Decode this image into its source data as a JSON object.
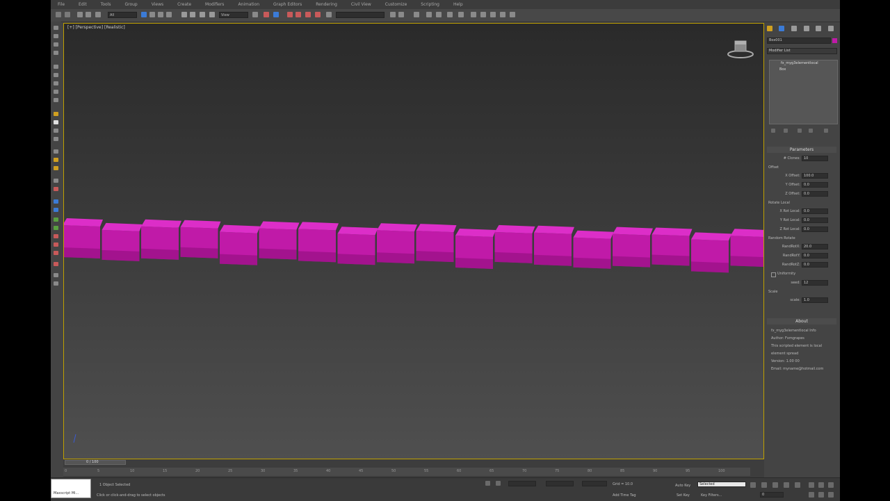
{
  "menu": [
    "File",
    "Edit",
    "Tools",
    "Group",
    "Views",
    "Create",
    "Modifiers",
    "Animation",
    "Graph Editors",
    "Rendering",
    "Civil View",
    "Customize",
    "Scripting",
    "Help"
  ],
  "toolbar": {
    "selection_set": "All",
    "reference_coord": "View",
    "named_selection": ""
  },
  "viewport": {
    "labels": [
      "[+]",
      "[Perspective]",
      "[Realistic]"
    ],
    "box_color": "#c01aa8",
    "box_top_color": "#dc2ec8",
    "box_dark_color": "#8a0f78"
  },
  "command_panel": {
    "object_name": "Box001",
    "modifier_list_label": "Modifier List",
    "stack": [
      "fx_myg3elementlocal",
      "Box"
    ],
    "params_title": "Parameters",
    "fields": [
      {
        "label": "# Clones:",
        "value": "10"
      },
      {
        "section": "Offset"
      },
      {
        "label": "X Offset:",
        "value": "100.0"
      },
      {
        "label": "Y Offset:",
        "value": "0.0"
      },
      {
        "label": "Z Offset:",
        "value": "0.0"
      },
      {
        "section": "Rotate Local"
      },
      {
        "label": "X Rot Local:",
        "value": "0.0"
      },
      {
        "label": "Y Rot Local:",
        "value": "0.0"
      },
      {
        "label": "Z Rot Local:",
        "value": "0.0"
      },
      {
        "section": "Random Rotate"
      },
      {
        "label": "RandRotX:",
        "value": "20.0"
      },
      {
        "label": "RandRotY:",
        "value": "0.0"
      },
      {
        "label": "RandRotZ:",
        "value": "0.0"
      },
      {
        "checkbox": "Uniformity"
      },
      {
        "label": "seed:",
        "value": "12"
      },
      {
        "section": "Scale"
      },
      {
        "label": "scale:",
        "value": "1.0"
      }
    ],
    "about_title": "About",
    "about_lines": [
      "fx_myg3elementlocal Info",
      "Author: Fxmgrapes",
      "This scripted element is local",
      "element spread",
      "Version: 1.00 00",
      "Email: myname@hotmail.com"
    ]
  },
  "timeline": {
    "frame_label": "0 / 100",
    "ticks": [
      "0",
      "5",
      "10",
      "15",
      "20",
      "25",
      "30",
      "35",
      "40",
      "45",
      "50",
      "55",
      "60",
      "65",
      "70",
      "75",
      "80",
      "85",
      "90",
      "95",
      "100"
    ]
  },
  "status": {
    "maxscript_label": "Maxscript Mi...",
    "selected": "1 Object Selected",
    "prompt": "Click or click-and-drag to select objects",
    "grid": "Grid = 10.0",
    "add_time_tag": "Add Time Tag",
    "auto_key": "Auto Key",
    "selected_dropdown": "Selected",
    "set_key": "Set Key",
    "key_filters": "Key Filters...",
    "frame": "0",
    "x": "",
    "y": "",
    "z": ""
  }
}
